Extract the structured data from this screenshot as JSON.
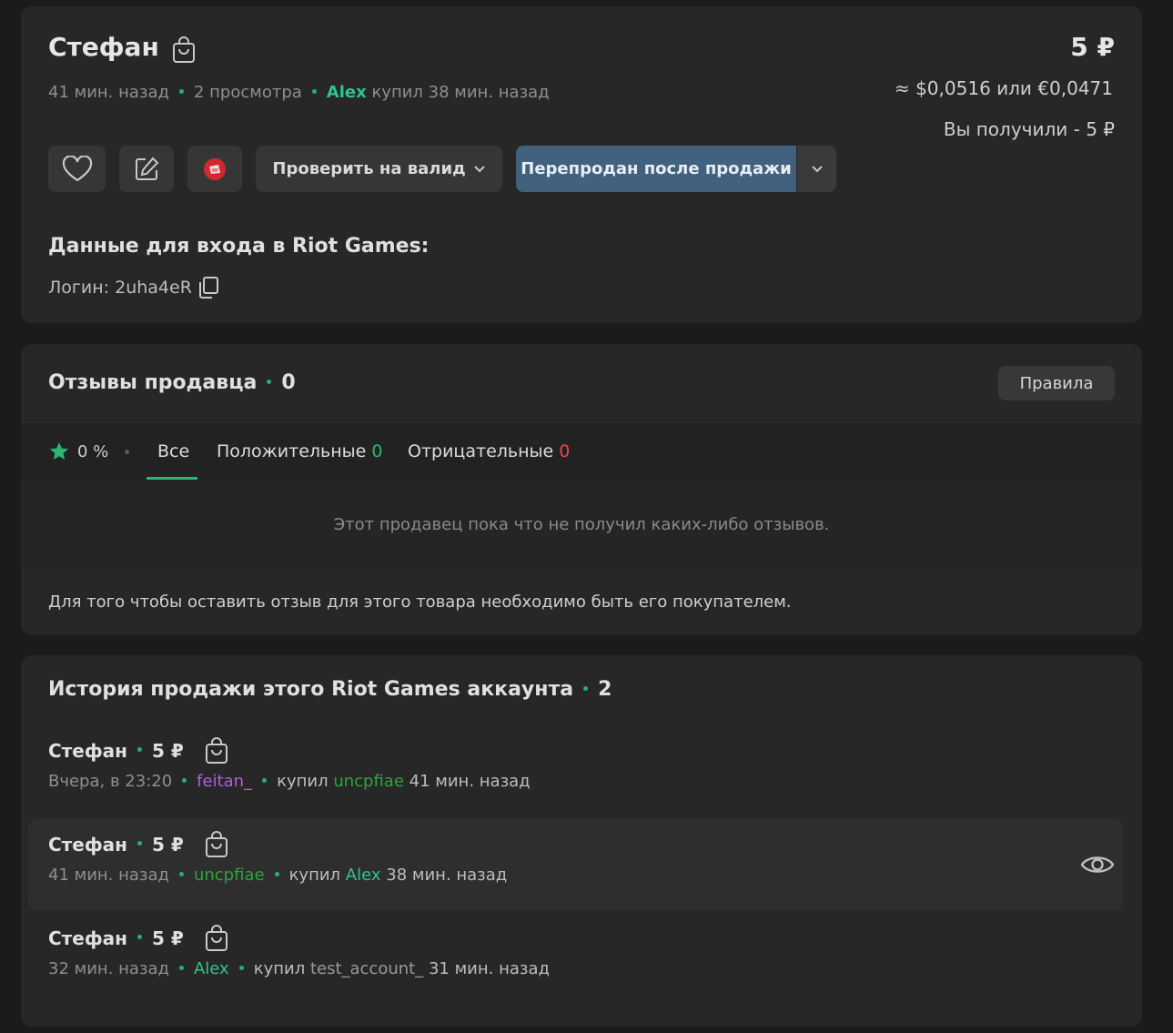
{
  "listing": {
    "title": "Стефан",
    "time_ago": "41 мин. назад",
    "views": "2 просмотра",
    "buyer": "Alex",
    "bought_text": "купил 38 мин. назад",
    "price": "5 ₽",
    "price_converted": "≈ $0,0516 или €0,0471",
    "received": "Вы получили - 5 ₽",
    "check_valid_label": "Проверить на валид",
    "resold_label": "Перепродан после продажи",
    "login_header": "Данные для входа в Riot Games:",
    "login_text": "Логин: 2uha4eR"
  },
  "reviews": {
    "title": "Отзывы продавца",
    "count": "0",
    "rules_label": "Правила",
    "rating": "0 %",
    "tab_all": "Все",
    "tab_positive": "Положительные",
    "positive_count": "0",
    "tab_negative": "Отрицательные",
    "negative_count": "0",
    "empty_text": "Этот продавец пока что не получил каких-либо отзывов.",
    "notice": "Для того чтобы оставить отзыв для этого товара необходимо быть его покупателем."
  },
  "history": {
    "title": "История продажи этого Riot Games аккаунта",
    "count": "2",
    "rows": [
      {
        "title": "Стефан",
        "price": "5 ₽",
        "time": "Вчера, в 23:20",
        "seller": "feitan_",
        "bought": "купил",
        "buyer": "uncpfiae",
        "suffix": "41 мин. назад"
      },
      {
        "title": "Стефан",
        "price": "5 ₽",
        "time": "41 мин. назад",
        "seller": "uncpfiae",
        "bought": "купил",
        "buyer": "Alex",
        "suffix": "38 мин. назад"
      },
      {
        "title": "Стефан",
        "price": "5 ₽",
        "time": "32 мин. назад",
        "seller": "Alex",
        "bought": "купил",
        "buyer": "test_account_",
        "suffix": "31 мин. назад"
      }
    ]
  },
  "colors": {
    "background": "#1b1b1b",
    "card": "#272727",
    "accent_green": "#2fc48a",
    "primary_button": "#41617e",
    "negative": "#e6484d"
  }
}
